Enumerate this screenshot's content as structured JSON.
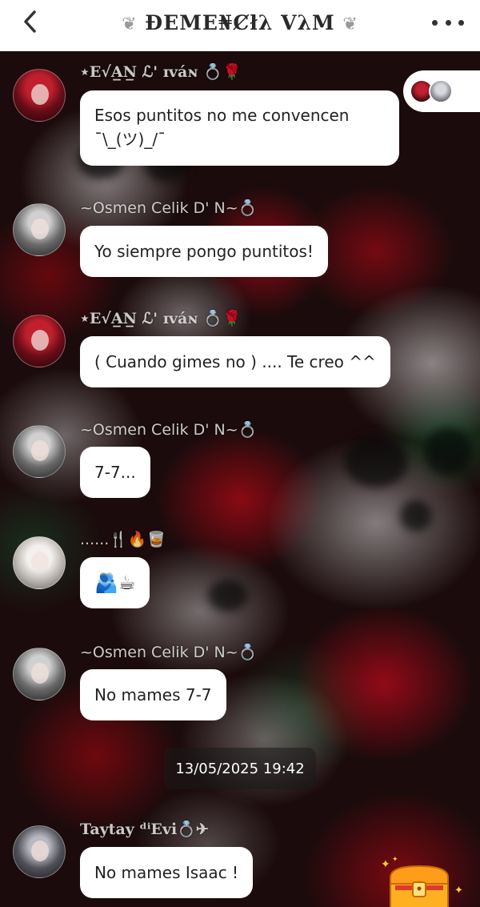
{
  "header": {
    "title": "ÐEME₦Ȼłλ VλM",
    "back_icon": "chevron-left-icon",
    "menu_icon": "more-dots-icon"
  },
  "messages": [
    {
      "sender": "⋆E√A̲N̲ ℒ' ɪváɴ 💍🌹",
      "avatar": "red-hair-avatar",
      "text": "Esos puntitos no me convencen ¯\\_(ツ)_/¯"
    },
    {
      "sender": "~Osmen Celik D' N~💍",
      "avatar": "gray-hair-avatar",
      "text": "Yo siempre pongo puntitos!"
    },
    {
      "sender": "⋆E√A̲N̲ ℒ' ɪváɴ 💍🌹",
      "avatar": "red-hair-avatar",
      "text": "( Cuando gimes no ) .... Te creo ^^"
    },
    {
      "sender": "~Osmen Celik D' N~💍",
      "avatar": "gray-hair-avatar",
      "text": "7-7..."
    },
    {
      "sender": "......🍴🔥🥃",
      "avatar": "pale-avatar",
      "text": "🫂☕"
    },
    {
      "sender": "~Osmen Celik D' N~💍",
      "avatar": "gray-hair-avatar",
      "text": "No mames 7-7"
    },
    {
      "sender": "Taytay ᵈⁱEvi💍✈",
      "avatar": "dark-hair-avatar",
      "text": "No mames Isaac !"
    }
  ],
  "timestamp": "13/05/2025 19:42",
  "widgets": {
    "group_avatars": "group-members-avatars",
    "treasure_icon": "treasure-chest-icon"
  }
}
